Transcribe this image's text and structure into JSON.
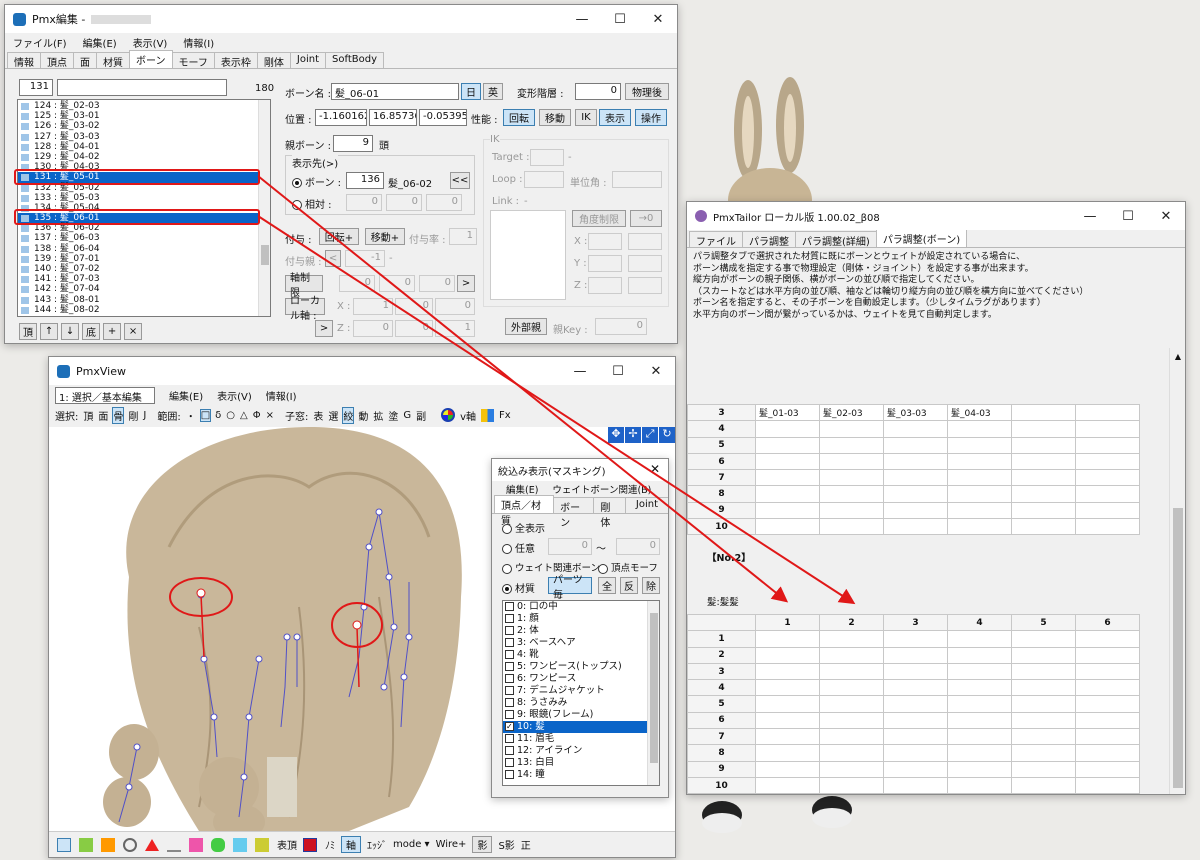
{
  "pmx_editor": {
    "title": "Pmx編集 -",
    "menu": [
      "ファイル(F)",
      "編集(E)",
      "表示(V)",
      "情報(I)"
    ],
    "tabs": [
      "情報",
      "頂点",
      "面",
      "材質",
      "ボーン",
      "モーフ",
      "表示枠",
      "剛体",
      "Joint",
      "SoftBody"
    ],
    "active_tab": "ボーン",
    "index_value": "131",
    "count": "180",
    "bone_list": [
      "124 : 髪_02-03",
      "125 : 髪_03-01",
      "126 : 髪_03-02",
      "127 : 髪_03-03",
      "128 : 髪_04-01",
      "129 : 髪_04-02",
      "130 : 髪_04-03",
      "131 : 髪_05-01",
      "132 : 髪_05-02",
      "133 : 髪_05-03",
      "134 : 髪_05-04",
      "135 : 髪_06-01",
      "136 : 髪_06-02",
      "137 : 髪_06-03",
      "138 : 髪_06-04",
      "139 : 髪_07-01",
      "140 : 髪_07-02",
      "141 : 髪_07-03",
      "142 : 髪_07-04",
      "143 : 髪_08-01",
      "144 : 髪_08-02"
    ],
    "list_buttons": [
      "頂",
      "↑",
      "↓",
      "底",
      "+",
      "×"
    ],
    "bone_name_label": "ボーン名 :",
    "bone_name_value": "髪_06-01",
    "lang_btn_jp": "日",
    "lang_btn_en": "英",
    "deform_layer_label": "変形階層 :",
    "deform_layer_value": "0",
    "physics_after": "物理後",
    "position_label": "位置 :",
    "pos_x": "-1.160162",
    "pos_y": "16.85736",
    "pos_z": "-0.053950",
    "performance_label": "性能 :",
    "perf_buttons": [
      "回転",
      "移動",
      "IK",
      "表示",
      "操作"
    ],
    "parent_bone_label": "親ボーン :",
    "parent_bone_value": "9",
    "parent_bone_name": "頭",
    "display_target_label": "表示先(>)",
    "radio_bone_label": "ボーン :",
    "target_bone_value": "136",
    "target_bone_name": "髪_06-02",
    "target_btn": "<<",
    "radio_relative_label": "相対 :",
    "rel_values": [
      "0",
      "0",
      "0"
    ],
    "ik_label": "IK",
    "ik_target_label": "Target :",
    "ik_target_value": "-",
    "ik_loop_label": "Loop :",
    "ik_unit_angle_label": "単位角 :",
    "ik_link_label": "Link :",
    "ik_link_value": "-",
    "angle_limit_btn": "角度制限",
    "arrow_zero_btn": "→0",
    "xyz": [
      "X :",
      "Y :",
      "Z :"
    ],
    "grant_label": "付与 :",
    "grant_rot_btn": "回転+",
    "grant_move_btn": "移動+",
    "grant_rate_label": "付与率 :",
    "grant_rate_value": "1",
    "grant_parent_label": "付与親 :",
    "grant_parent_value": "-1",
    "grant_parent_dash": "-",
    "axis_limit_btn": "軸制限",
    "axis_values": [
      "0",
      "0",
      "0"
    ],
    "axis_arrow": ">",
    "local_axis_btn": "ローカル軸 :",
    "local_x_label": "X :",
    "local_z_label": "Z :",
    "local_x_values": [
      "1",
      "0",
      "0"
    ],
    "local_z_values": [
      "0",
      "0",
      "1"
    ],
    "local_arrow": ">",
    "external_parent_btn": "外部親",
    "parent_key_label": "親Key :",
    "parent_key_value": "0"
  },
  "pmx_view": {
    "title": "PmxView",
    "mode_select": "1: 選択／基本編集",
    "menu": [
      "編集(E)",
      "表示(V)",
      "情報(I)"
    ],
    "toolbar_select_label": "選択:",
    "toolbar_select_items": [
      "頂",
      "面",
      "骨",
      "剛",
      "J"
    ],
    "toolbar_range_label": "範囲:",
    "toolbar_range_items": [
      "・",
      "□",
      "δ",
      "○",
      "△",
      "Φ",
      "×"
    ],
    "toolbar_child_label": "子窓:",
    "toolbar_child_items": [
      "表",
      "選",
      "絞",
      "動",
      "拡",
      "塗",
      "G",
      "副"
    ],
    "toolbar_vaxis": "v軸",
    "toolbar_fx": "Fx",
    "bottom_toolbar": [
      "表頂",
      "ﾉﾐ",
      "軸",
      "ｴｯｼﾞ",
      "mode ▾",
      "Wire+",
      "影",
      "S影",
      "正"
    ]
  },
  "filter_window": {
    "title": "絞込み表示(マスキング)",
    "menu": [
      "編集(E)",
      "ウェイトボーン関連(B)"
    ],
    "tabs": [
      "頂点／材質",
      "ボーン",
      "剛体",
      "Joint"
    ],
    "active_tab": "頂点／材質",
    "all_display": "全表示",
    "arbitrary": "任意",
    "arb_from": "0",
    "tilde": "〜",
    "arb_to": "0",
    "weight_bone": "ウェイト関連ボーン",
    "vertex_morph": "頂点モーフ",
    "material": "材質",
    "parts_btn": "パーツ毎",
    "all_btn": "全",
    "invert_btn": "反",
    "remove_btn": "除",
    "materials": [
      "0: 口の中",
      "1: 顔",
      "2: 体",
      "3: ベースヘア",
      "4: 靴",
      "5: ワンピース(トップス)",
      "6: ワンピース",
      "7: デニムジャケット",
      "8: うさみみ",
      "9: 眼鏡(フレーム)",
      "10: 髪",
      "11: 眉毛",
      "12: アイライン",
      "13: 白目",
      "14: 瞳"
    ],
    "selected_material": "10: 髪"
  },
  "tailor": {
    "title": "PmxTailor ローカル版 1.00.02_β08",
    "tabs": [
      "ファイル",
      "パラ調整",
      "パラ調整(詳細)",
      "パラ調整(ボーン)"
    ],
    "active_tab": "パラ調整(ボーン)",
    "description": [
      "パラ調整タブで選択された材質に既にボーンとウェイトが設定されている場合に、",
      "ボーン構成を指定する事で物理設定（剛体・ジョイント）を設定する事が出来ます。",
      "縦方向がボーンの親子関係、横がボーンの並び順で指定してください。",
      "（スカートなどは水平方向の並び順、袖などは輪切り縦方向の並び順を横方向に並べてください）",
      "ボーン名を指定すると、その子ボーンを自動設定します。（少しタイムラグがあります）",
      "水平方向のボーン間が繋がっているかは、ウェイトを見て自動判定します。"
    ],
    "table1_rows": [
      "3",
      "4",
      "5",
      "6",
      "7",
      "8",
      "9",
      "10"
    ],
    "table1_row3": [
      "髪_01-03",
      "髪_02-03",
      "髪_03-03",
      "髪_04-03"
    ],
    "section_no2": "【No.2】",
    "material_name": "髪:髪髪",
    "table2_cols": [
      "1",
      "2",
      "3",
      "4",
      "5",
      "6"
    ],
    "table2_rows": [
      "1",
      "2",
      "3",
      "4",
      "5",
      "6",
      "7",
      "8",
      "9",
      "10"
    ]
  },
  "colors": {
    "selection": "#0a64c8",
    "highlight_red": "#e01818",
    "bone_blue": "#5050c8",
    "hair": "#c9b79a"
  }
}
